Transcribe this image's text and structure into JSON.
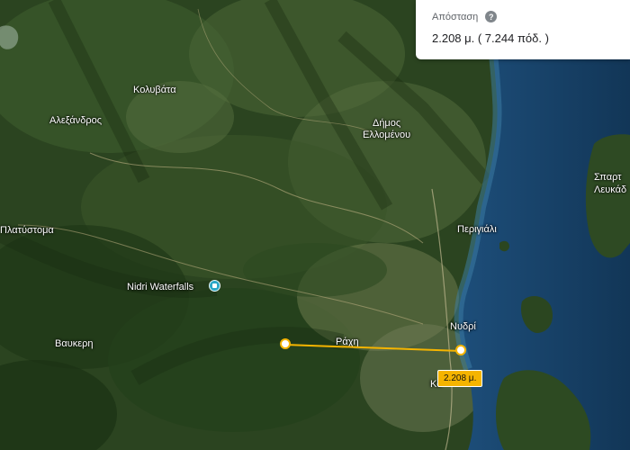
{
  "places": [
    {
      "id": "kolyvata",
      "label": "Κολυβάτα"
    },
    {
      "id": "alexandros",
      "label": "Αλεξάνδρος"
    },
    {
      "id": "dimos-ellomenou",
      "label": "Δήμος\nΕλλομένου"
    },
    {
      "id": "platystoma",
      "label": "Πλατύστομα"
    },
    {
      "id": "perigiali",
      "label": "Περιγιάλι"
    },
    {
      "id": "spartochori",
      "label": "Σπαρτ\nΛευκάδ"
    },
    {
      "id": "nidri-waterfalls",
      "label": "Nidri Waterfalls"
    },
    {
      "id": "vafkeri",
      "label": "Βαυκερη"
    },
    {
      "id": "rachi",
      "label": "Ράχη"
    },
    {
      "id": "nydri",
      "label": "Νυδρί"
    },
    {
      "id": "ko",
      "label": "Κο"
    }
  ],
  "measure": {
    "badge_label": "2.208 μ."
  },
  "distance_panel": {
    "title": "Απόσταση",
    "help_icon": "?",
    "value": "2.208 μ.  ( 7.244 πόδ. )"
  },
  "colors": {
    "measure_line": "#f5b400",
    "poi": "#2aa7c6"
  }
}
